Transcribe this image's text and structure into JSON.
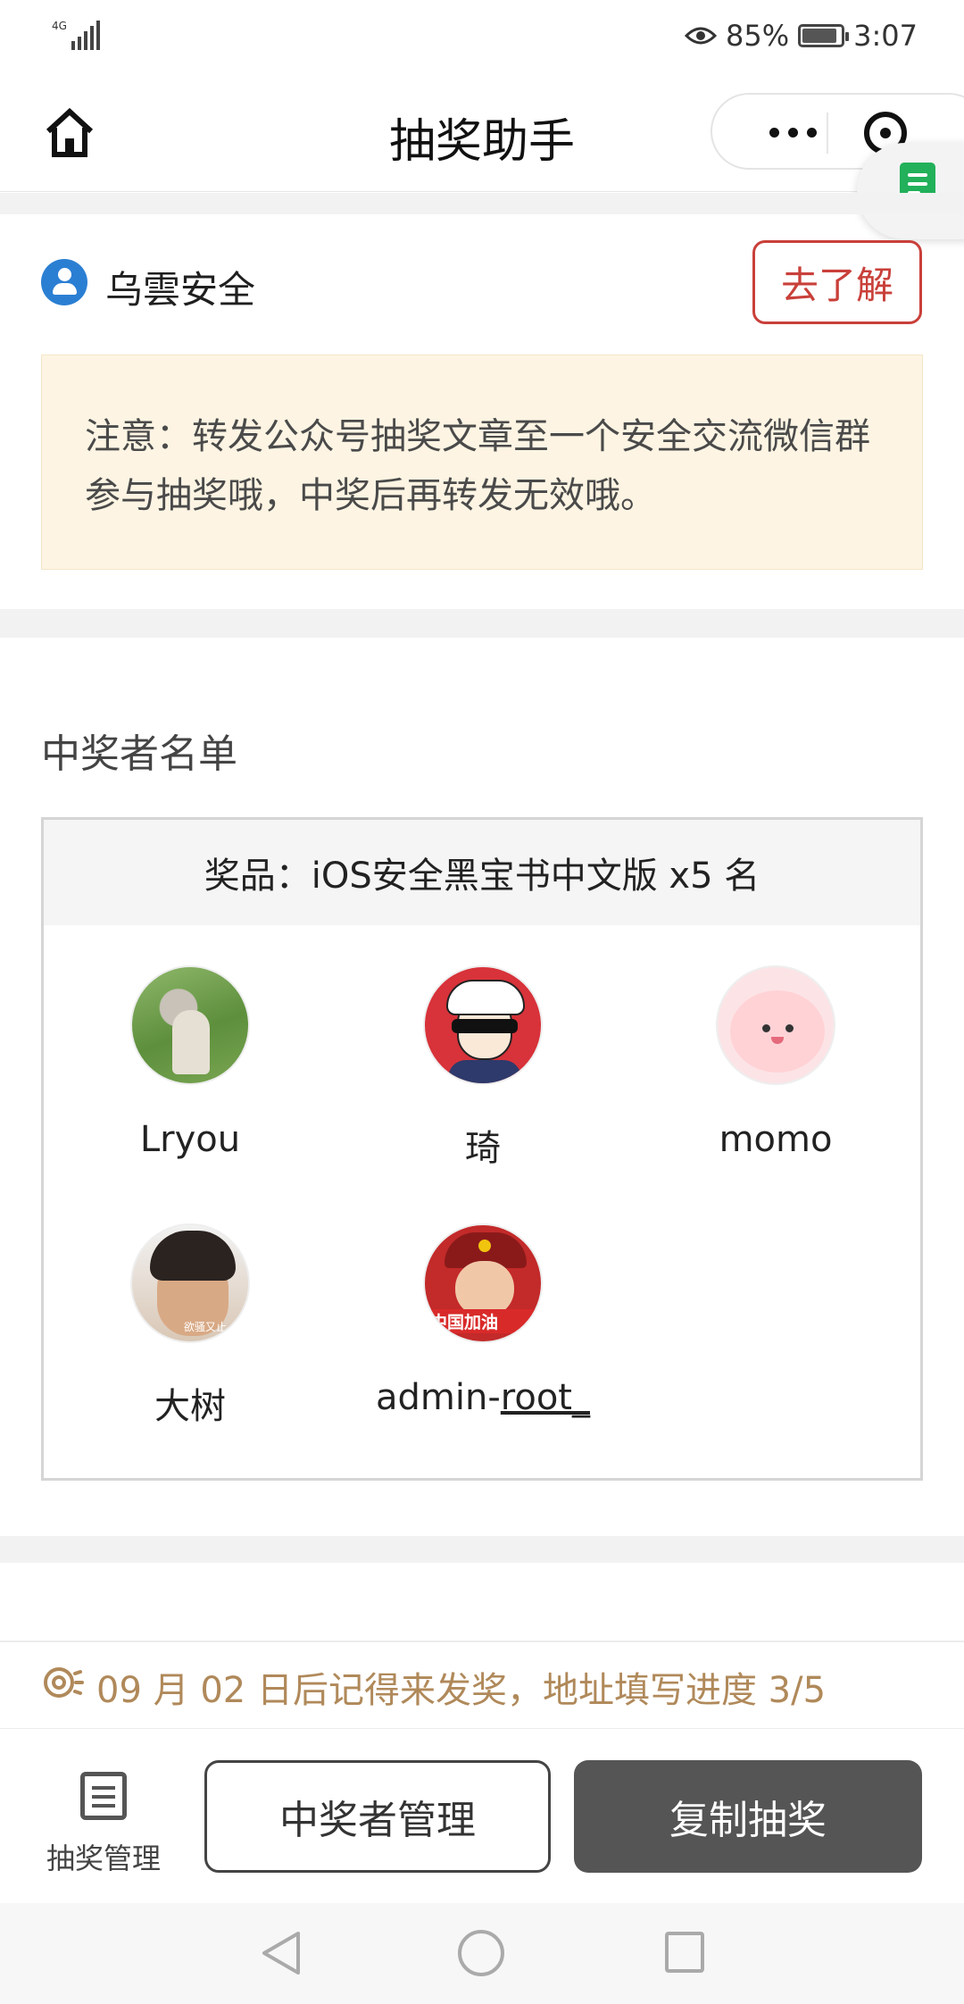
{
  "status_bar": {
    "network": "4G",
    "battery_percent": "85%",
    "battery_level": 0.85,
    "time": "3:07",
    "icons": [
      "signal-icon",
      "eye-icon",
      "battery-icon"
    ]
  },
  "header": {
    "title": "抽奖助手",
    "icons": [
      "home-icon",
      "more-icon",
      "target-icon",
      "doc-icon"
    ]
  },
  "org": {
    "name": "乌雲安全",
    "learn_more": "去了解"
  },
  "notice": {
    "text": "注意：转发公众号抽奖文章至一个安全交流微信群参与抽奖哦，中奖后再转发无效哦。"
  },
  "winners": {
    "label": "中奖者名单",
    "prize": "奖品：iOS安全黑宝书中文版 x5 名",
    "list": [
      {
        "name": "Lryou"
      },
      {
        "name": "琦"
      },
      {
        "name": "momo"
      },
      {
        "name": "大树"
      },
      {
        "name_prefix": "admin-",
        "name_underlined": "root_"
      }
    ],
    "avatar5_banner": "中国加油",
    "avatar4_caption": "欲骚又止"
  },
  "reminder": {
    "text": "09 月 02 日后记得来发奖，地址填写进度 3/5",
    "icon": "eye-bell-icon"
  },
  "bottom_bar": {
    "manage_label": "抽奖管理",
    "winner_manage": "中奖者管理",
    "copy_lottery": "复制抽奖"
  },
  "nav_bar": {
    "icons": [
      "back-icon",
      "home-circle-icon",
      "recent-apps-icon"
    ]
  },
  "colors": {
    "accent_red": "#c9403a",
    "notice_bg": "#fdf4e3",
    "reminder_text": "#b0895a",
    "solid_button": "#555555",
    "org_icon": "#2b7fd3"
  }
}
